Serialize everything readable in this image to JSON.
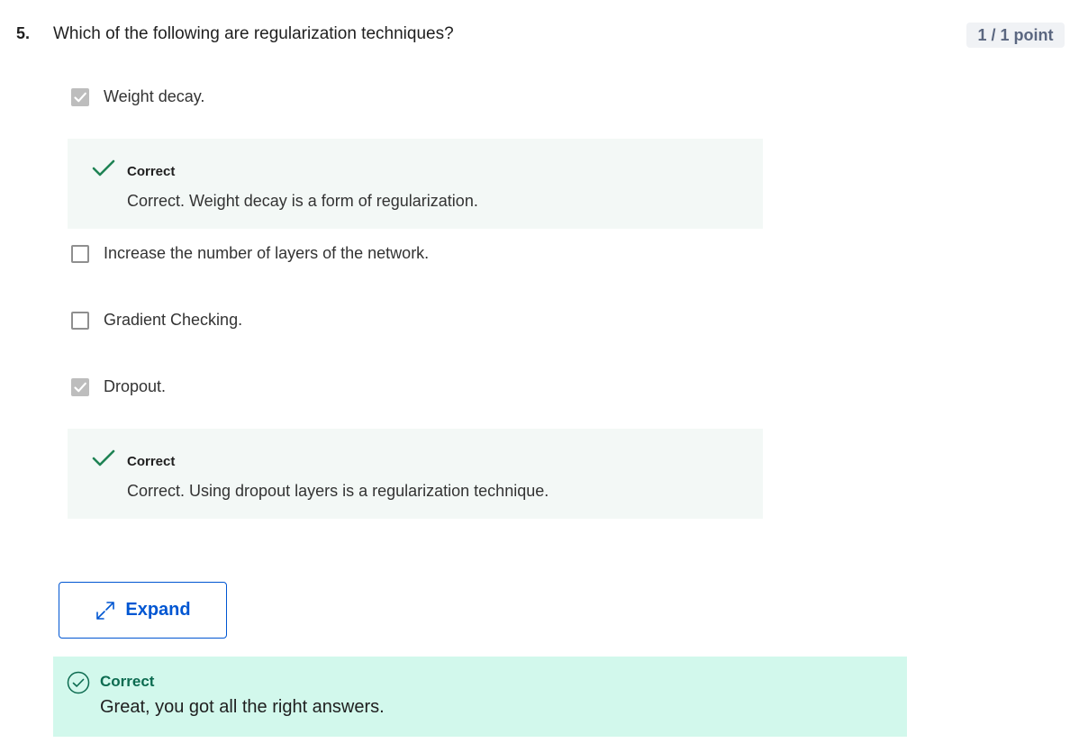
{
  "question": {
    "number": "5.",
    "text": "Which of the following are regularization techniques?",
    "points": "1 / 1 point"
  },
  "options": [
    {
      "label": "Weight decay.",
      "checked": true,
      "feedback": {
        "title": "Correct",
        "text": "Correct. Weight decay is a form of regularization."
      }
    },
    {
      "label": "Increase the number of layers of the network.",
      "checked": false
    },
    {
      "label": "Gradient Checking.",
      "checked": false
    },
    {
      "label": "Dropout.",
      "checked": true,
      "feedback": {
        "title": "Correct",
        "text": "Correct. Using dropout layers is a regularization technique."
      }
    }
  ],
  "expand_button": {
    "label": "Expand",
    "icon": "expand-diagonal-arrows-icon"
  },
  "result": {
    "title": "Correct",
    "message": "Great, you got all the right answers.",
    "icon": "check-circle-icon"
  },
  "colors": {
    "accent_blue": "#0056d2",
    "correct_green": "#1f8354",
    "result_green_text": "#0c6b50",
    "result_bg": "#d2f8ec",
    "feedback_bg": "#f3f8f6",
    "checked_box": "#bdbdbd",
    "badge_bg": "#f0f2f5"
  }
}
